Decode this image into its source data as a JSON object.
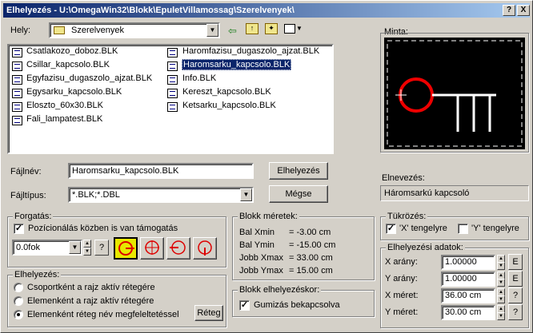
{
  "title": "Elhelyezés - U:\\OmegaWin32\\Blokk\\EpuletVillamossag\\Szerelvenyek\\",
  "title_buttons": {
    "help": "?",
    "close": "X"
  },
  "location": {
    "label": "Hely:",
    "value": "Szerelvenyek"
  },
  "files_col1": [
    "Csatlakozo_doboz.BLK",
    "Csillar_kapcsolo.BLK",
    "Egyfazisu_dugaszolo_ajzat.BLK",
    "Egysarku_kapcsolo.BLK",
    "Eloszto_60x30.BLK",
    "Fali_lampatest.BLK"
  ],
  "files_col2": [
    "Haromfazisu_dugaszolo_ajzat.BLK",
    "Haromsarku_kapcsolo.BLK",
    "Info.BLK",
    "Kereszt_kapcsolo.BLK",
    "Ketsarku_kapcsolo.BLK"
  ],
  "filename": {
    "label": "Fájlnév:",
    "value": "Haromsarku_kapcsolo.BLK"
  },
  "filetype": {
    "label": "Fájltípus:",
    "value": "*.BLK;*.DBL"
  },
  "buttons": {
    "place": "Elhelyezés",
    "cancel": "Mégse",
    "layer": "Réteg"
  },
  "preview": {
    "label": "Minta:"
  },
  "name": {
    "label": "Elnevezés:",
    "value": "Háromsarkú kapcsoló"
  },
  "rotation": {
    "group": "Forgatás:",
    "checkbox": "Pozícionálás közben is van támogatás",
    "value": "0.0fok",
    "help": "?"
  },
  "block_size": {
    "group": "Blokk méretek:",
    "rows": [
      {
        "label": "Bal Xmin",
        "value": "= -3.00 cm"
      },
      {
        "label": "Bal Ymin",
        "value": "= -15.00 cm"
      },
      {
        "label": "Jobb Xmax",
        "value": "= 33.00 cm"
      },
      {
        "label": "Jobb Ymax",
        "value": "= 15.00 cm"
      }
    ]
  },
  "block_place_group": {
    "group": "Blokk elhelyezéskor:",
    "checkbox": "Gumizás bekapcsolva"
  },
  "mirror": {
    "group": "Tükrözés:",
    "x": "'X' tengelyre",
    "y": "'Y' tengelyre"
  },
  "placement_group": {
    "group": "Elhelyezés:",
    "options": [
      "Csoportként a rajz aktív rétegére",
      "Elemenként a rajz aktív rétegére",
      "Elemenként réteg név megfeleltetéssel"
    ]
  },
  "place_data": {
    "group": "Elhelyezési adatok:",
    "rows": [
      {
        "label": "X arány:",
        "value": "1.00000",
        "btn": "E"
      },
      {
        "label": "Y arány:",
        "value": "1.00000",
        "btn": "E"
      },
      {
        "label": "X méret:",
        "value": "36.00 cm",
        "btn": "?"
      },
      {
        "label": "Y méret:",
        "value": "30.00 cm",
        "btn": "?"
      }
    ]
  }
}
